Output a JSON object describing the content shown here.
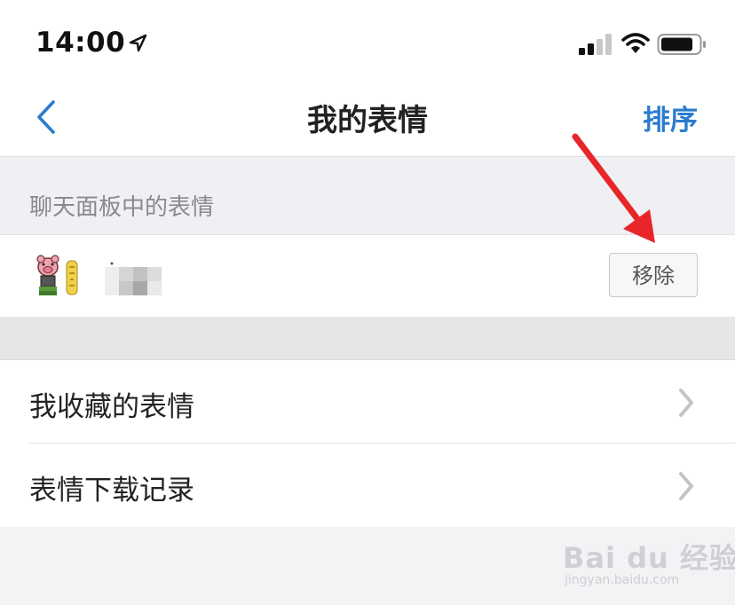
{
  "status_bar": {
    "time": "14:00",
    "icons": [
      "location-arrow-icon",
      "signal-icon",
      "wifi-icon",
      "battery-icon"
    ]
  },
  "nav": {
    "title": "我的表情",
    "sort_label": "排序",
    "back_icon": "chevron-left-icon",
    "accent_color": "#2a7ccd"
  },
  "panel_section": {
    "header": "聊天面板中的表情",
    "sticker": {
      "thumb_icon": "pig-sticker-icon",
      "remove_label": "移除"
    }
  },
  "menu": {
    "items": [
      {
        "label": "我收藏的表情"
      },
      {
        "label": "表情下载记录"
      }
    ]
  },
  "watermark": {
    "main": "Bai du 经验",
    "sub": "jingyan.baidu.com"
  }
}
